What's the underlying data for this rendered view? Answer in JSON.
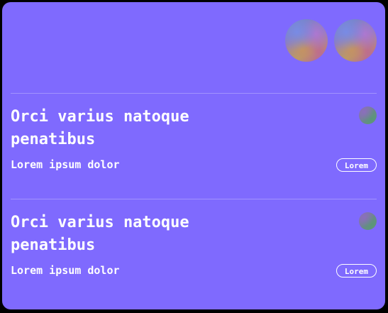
{
  "header": {
    "avatars": [
      "avatar",
      "avatar"
    ]
  },
  "items": [
    {
      "title": "Orci varius natoque penatibus",
      "subtitle": "Lorem ipsum dolor",
      "tag_label": "Lorem"
    },
    {
      "title": "Orci varius natoque penatibus",
      "subtitle": "Lorem ipsum dolor",
      "tag_label": "Lorem"
    }
  ],
  "colors": {
    "page_background": "#000000",
    "card_background": "#7f6afe",
    "text": "#ffffff",
    "divider": "#ffffff"
  }
}
